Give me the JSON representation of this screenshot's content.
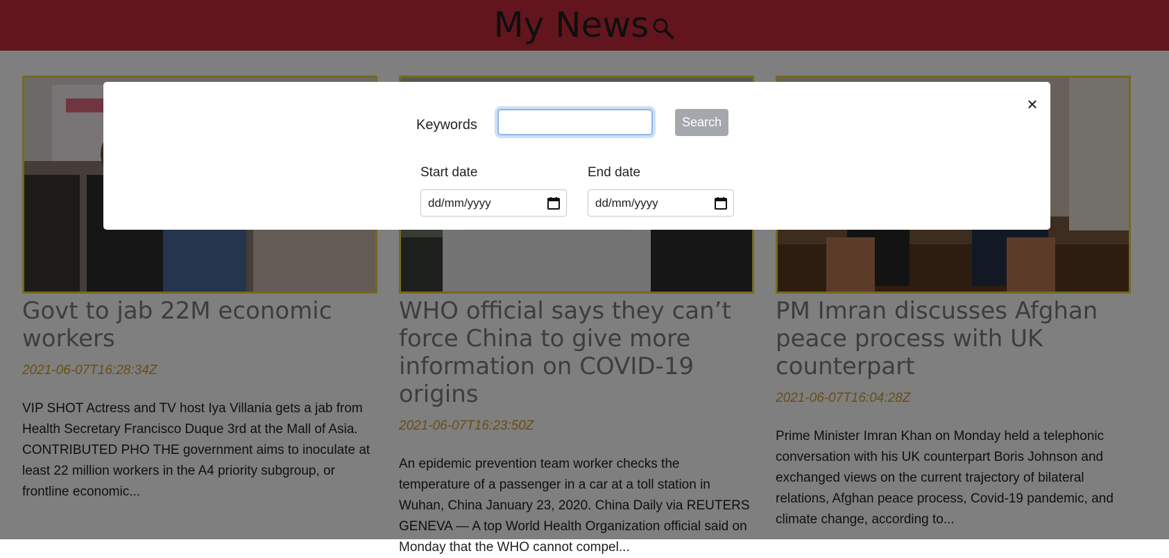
{
  "header": {
    "title": "My News",
    "icon": "search-icon"
  },
  "articles": [
    {
      "title": "Govt to jab 22M economic workers",
      "date": "2021-06-07T16:28:34Z",
      "description": "VIP SHOT Actress and TV host Iya Villania gets a jab from Health Secretary Francisco Duque 3rd at the Mall of Asia. CONTRIBUTED PHO THE government aims to inoculate at least 22 million workers in the A4 priority subgroup, or frontline economic..."
    },
    {
      "title": "WHO official says they can’t force China to give more information on COVID-19 origins",
      "date": "2021-06-07T16:23:50Z",
      "description": "An epidemic prevention team worker checks the temperature of a passenger in a car at a toll station in Wuhan, China January 23, 2020. China Daily via REUTERS GENEVA — A top World Health Organization official said on Monday that the WHO cannot compel..."
    },
    {
      "title": "PM Imran discusses Afghan peace process with UK counterpart",
      "date": "2021-06-07T16:04:28Z",
      "description": "Prime Minister Imran Khan on Monday held a telephonic conversation with his UK counterpart Boris Johnson and exchanged views on the current trajectory of bilateral relations, Afghan peace process, Covid-19 pandemic, and climate change, according to..."
    }
  ],
  "search_modal": {
    "close_label": "×",
    "keywords_label": "Keywords",
    "keywords_value": "",
    "search_button": "Search",
    "start_date_label": "Start date",
    "start_date_value": "dd/mm/yyyy",
    "end_date_label": "End date",
    "end_date_value": "dd/mm/yyyy"
  },
  "colors": {
    "header_bg": "#c62a3a",
    "date_text": "#d39a2b",
    "image_border": "#e8d23c",
    "search_button_bg": "#a4a8ad"
  }
}
